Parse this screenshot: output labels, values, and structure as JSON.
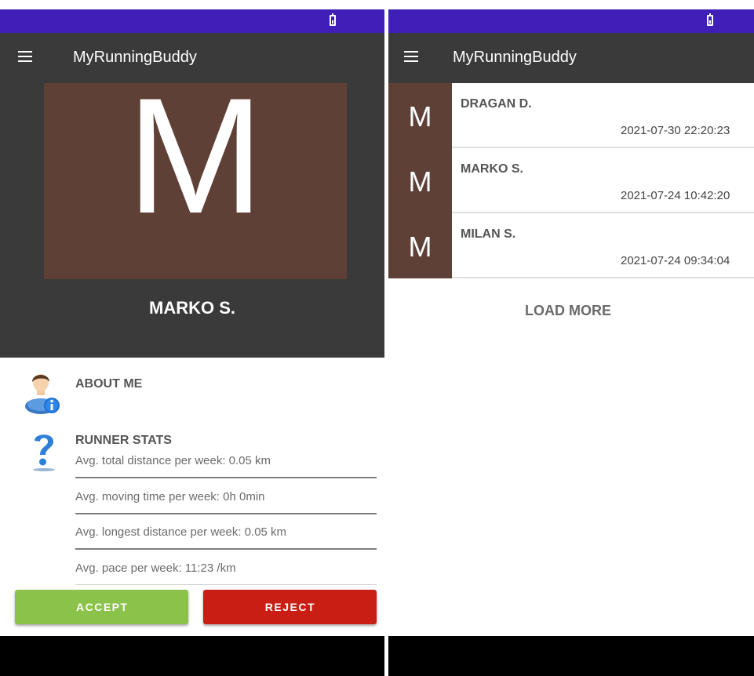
{
  "left_screen": {
    "app_title": "MyRunningBuddy",
    "profile": {
      "avatar_letter": "M",
      "avatar_color": "#5e4036",
      "name": "MARKO S."
    },
    "about": {
      "icon": "user-info-icon",
      "heading": "ABOUT ME"
    },
    "stats": {
      "icon": "question-mark-icon",
      "heading": "RUNNER STATS",
      "items": [
        "Avg. total distance per week: 0.05 km",
        "Avg. moving time per week: 0h 0min",
        "Avg. longest distance per week: 0.05 km",
        "Avg. pace per week: 11:23 /km"
      ]
    },
    "actions": {
      "accept_label": "ACCEPT",
      "accept_color": "#8bc34a",
      "reject_label": "REJECT",
      "reject_color": "#c81e14"
    }
  },
  "right_screen": {
    "app_title": "MyRunningBuddy",
    "requests": [
      {
        "avatar_letter": "M",
        "name": "DRAGAN D.",
        "timestamp": "2021-07-30 22:20:23"
      },
      {
        "avatar_letter": "M",
        "name": "MARKO S.",
        "timestamp": "2021-07-24 10:42:20"
      },
      {
        "avatar_letter": "M",
        "name": "MILAN S.",
        "timestamp": "2021-07-24 09:34:04"
      }
    ],
    "load_more_label": "LOAD MORE"
  },
  "colors": {
    "status_bar": "#3f1fb8",
    "app_bar": "#3a3a3a",
    "avatar": "#5e4036"
  }
}
